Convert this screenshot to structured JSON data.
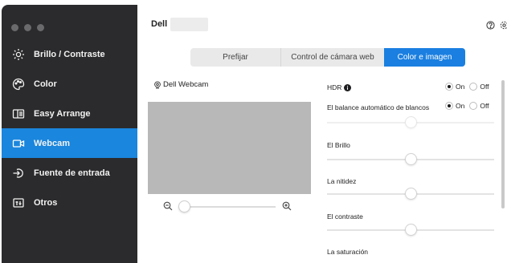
{
  "sidebar": {
    "items": [
      {
        "label": "Brillo / Contraste",
        "icon": "sun-icon",
        "active": false
      },
      {
        "label": "Color",
        "icon": "palette-icon",
        "active": false
      },
      {
        "label": "Easy Arrange",
        "icon": "layout-icon",
        "active": false
      },
      {
        "label": "Webcam",
        "icon": "webcam-icon",
        "active": true
      },
      {
        "label": "Fuente de entrada",
        "icon": "input-source-icon",
        "active": false
      },
      {
        "label": "Otros",
        "icon": "others-icon",
        "active": false
      }
    ]
  },
  "header": {
    "brand": "Dell",
    "help_icon": "help-icon",
    "settings_icon": "gear-icon"
  },
  "tabs": [
    {
      "label": "Prefijar",
      "active": false
    },
    {
      "label": "Control de cámara web",
      "active": false
    },
    {
      "label": "Color e imagen",
      "active": true
    }
  ],
  "webcam": {
    "title": "Dell Webcam",
    "zoom_level": 0.0
  },
  "settings": {
    "hdr": {
      "label": "HDR",
      "on_label": "On",
      "off_label": "Off",
      "selected": "On"
    },
    "auto_white_balance": {
      "label": "El balance automático de blancos",
      "on_label": "On",
      "off_label": "Off",
      "selected": "On",
      "level": 0.5
    },
    "brightness": {
      "label": "El Brillo",
      "level": 0.5
    },
    "sharpness": {
      "label": "La nitidez",
      "level": 0.5
    },
    "contrast": {
      "label": "El contraste",
      "level": 0.5
    },
    "saturation": {
      "label": "La saturación"
    }
  },
  "colors": {
    "sidebar_bg": "#2b2b2d",
    "accent": "#1a86dd",
    "tab_active": "#1a7fe0"
  }
}
